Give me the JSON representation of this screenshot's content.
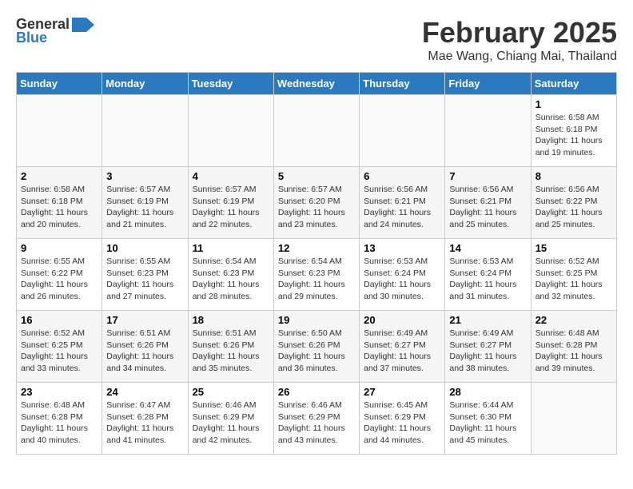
{
  "header": {
    "logo_general": "General",
    "logo_blue": "Blue",
    "title": "February 2025",
    "subtitle": "Mae Wang, Chiang Mai, Thailand"
  },
  "weekdays": [
    "Sunday",
    "Monday",
    "Tuesday",
    "Wednesday",
    "Thursday",
    "Friday",
    "Saturday"
  ],
  "weeks": [
    [
      {
        "day": "",
        "info": ""
      },
      {
        "day": "",
        "info": ""
      },
      {
        "day": "",
        "info": ""
      },
      {
        "day": "",
        "info": ""
      },
      {
        "day": "",
        "info": ""
      },
      {
        "day": "",
        "info": ""
      },
      {
        "day": "1",
        "info": "Sunrise: 6:58 AM\nSunset: 6:18 PM\nDaylight: 11 hours\nand 19 minutes."
      }
    ],
    [
      {
        "day": "2",
        "info": "Sunrise: 6:58 AM\nSunset: 6:18 PM\nDaylight: 11 hours\nand 20 minutes."
      },
      {
        "day": "3",
        "info": "Sunrise: 6:57 AM\nSunset: 6:19 PM\nDaylight: 11 hours\nand 21 minutes."
      },
      {
        "day": "4",
        "info": "Sunrise: 6:57 AM\nSunset: 6:19 PM\nDaylight: 11 hours\nand 22 minutes."
      },
      {
        "day": "5",
        "info": "Sunrise: 6:57 AM\nSunset: 6:20 PM\nDaylight: 11 hours\nand 23 minutes."
      },
      {
        "day": "6",
        "info": "Sunrise: 6:56 AM\nSunset: 6:21 PM\nDaylight: 11 hours\nand 24 minutes."
      },
      {
        "day": "7",
        "info": "Sunrise: 6:56 AM\nSunset: 6:21 PM\nDaylight: 11 hours\nand 25 minutes."
      },
      {
        "day": "8",
        "info": "Sunrise: 6:56 AM\nSunset: 6:22 PM\nDaylight: 11 hours\nand 25 minutes."
      }
    ],
    [
      {
        "day": "9",
        "info": "Sunrise: 6:55 AM\nSunset: 6:22 PM\nDaylight: 11 hours\nand 26 minutes."
      },
      {
        "day": "10",
        "info": "Sunrise: 6:55 AM\nSunset: 6:23 PM\nDaylight: 11 hours\nand 27 minutes."
      },
      {
        "day": "11",
        "info": "Sunrise: 6:54 AM\nSunset: 6:23 PM\nDaylight: 11 hours\nand 28 minutes."
      },
      {
        "day": "12",
        "info": "Sunrise: 6:54 AM\nSunset: 6:23 PM\nDaylight: 11 hours\nand 29 minutes."
      },
      {
        "day": "13",
        "info": "Sunrise: 6:53 AM\nSunset: 6:24 PM\nDaylight: 11 hours\nand 30 minutes."
      },
      {
        "day": "14",
        "info": "Sunrise: 6:53 AM\nSunset: 6:24 PM\nDaylight: 11 hours\nand 31 minutes."
      },
      {
        "day": "15",
        "info": "Sunrise: 6:52 AM\nSunset: 6:25 PM\nDaylight: 11 hours\nand 32 minutes."
      }
    ],
    [
      {
        "day": "16",
        "info": "Sunrise: 6:52 AM\nSunset: 6:25 PM\nDaylight: 11 hours\nand 33 minutes."
      },
      {
        "day": "17",
        "info": "Sunrise: 6:51 AM\nSunset: 6:26 PM\nDaylight: 11 hours\nand 34 minutes."
      },
      {
        "day": "18",
        "info": "Sunrise: 6:51 AM\nSunset: 6:26 PM\nDaylight: 11 hours\nand 35 minutes."
      },
      {
        "day": "19",
        "info": "Sunrise: 6:50 AM\nSunset: 6:26 PM\nDaylight: 11 hours\nand 36 minutes."
      },
      {
        "day": "20",
        "info": "Sunrise: 6:49 AM\nSunset: 6:27 PM\nDaylight: 11 hours\nand 37 minutes."
      },
      {
        "day": "21",
        "info": "Sunrise: 6:49 AM\nSunset: 6:27 PM\nDaylight: 11 hours\nand 38 minutes."
      },
      {
        "day": "22",
        "info": "Sunrise: 6:48 AM\nSunset: 6:28 PM\nDaylight: 11 hours\nand 39 minutes."
      }
    ],
    [
      {
        "day": "23",
        "info": "Sunrise: 6:48 AM\nSunset: 6:28 PM\nDaylight: 11 hours\nand 40 minutes."
      },
      {
        "day": "24",
        "info": "Sunrise: 6:47 AM\nSunset: 6:28 PM\nDaylight: 11 hours\nand 41 minutes."
      },
      {
        "day": "25",
        "info": "Sunrise: 6:46 AM\nSunset: 6:29 PM\nDaylight: 11 hours\nand 42 minutes."
      },
      {
        "day": "26",
        "info": "Sunrise: 6:46 AM\nSunset: 6:29 PM\nDaylight: 11 hours\nand 43 minutes."
      },
      {
        "day": "27",
        "info": "Sunrise: 6:45 AM\nSunset: 6:29 PM\nDaylight: 11 hours\nand 44 minutes."
      },
      {
        "day": "28",
        "info": "Sunrise: 6:44 AM\nSunset: 6:30 PM\nDaylight: 11 hours\nand 45 minutes."
      },
      {
        "day": "",
        "info": ""
      }
    ]
  ]
}
